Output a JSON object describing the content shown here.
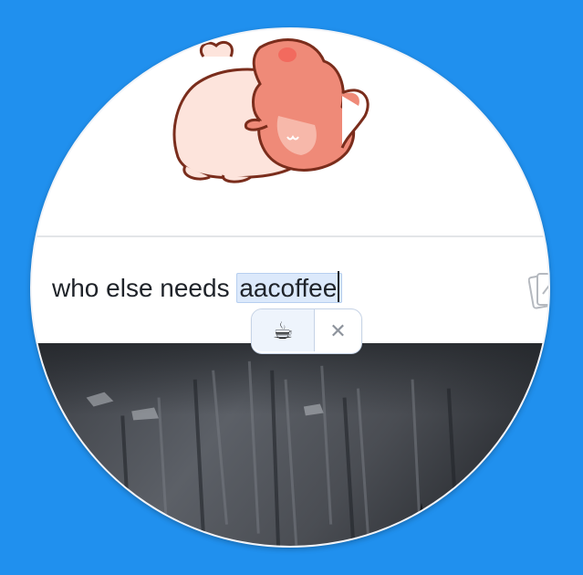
{
  "composer": {
    "text_before": "who else needs ",
    "highlighted_word": "aacoffee"
  },
  "suggestion": {
    "emoji": "☕",
    "dismiss_label": "✕"
  },
  "icons": {
    "attach": "attachment-icon",
    "emoji_suggestion": "coffee-icon",
    "dismiss": "close-icon"
  },
  "colors": {
    "background": "#2090ee",
    "highlight": "#dce9fb",
    "text": "#1f2329"
  }
}
